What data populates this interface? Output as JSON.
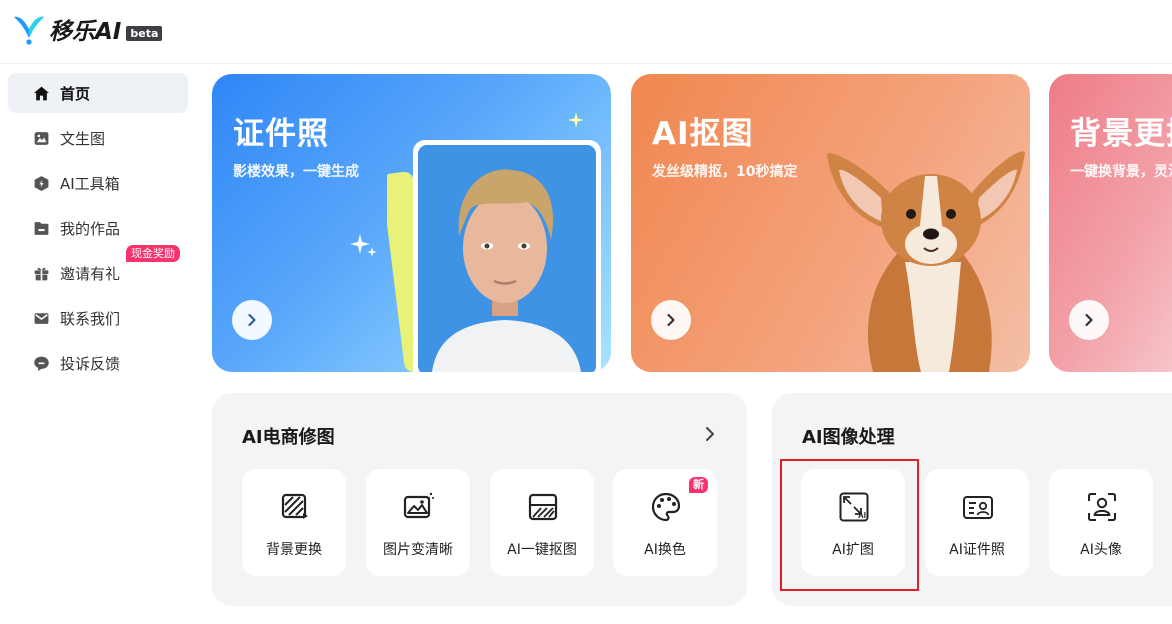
{
  "header": {
    "logo_text": "移乐AI",
    "badge": "beta"
  },
  "sidebar": {
    "items": [
      {
        "label": "首页",
        "icon": "home-icon"
      },
      {
        "label": "文生图",
        "icon": "image-icon"
      },
      {
        "label": "AI工具箱",
        "icon": "toolbox-icon"
      },
      {
        "label": "我的作品",
        "icon": "folder-icon"
      },
      {
        "label": "邀请有礼",
        "icon": "gift-icon",
        "badge": "现金奖励"
      },
      {
        "label": "联系我们",
        "icon": "mail-icon"
      },
      {
        "label": "投诉反馈",
        "icon": "chat-icon"
      }
    ]
  },
  "banners": [
    {
      "title": "证件照",
      "subtitle": "影楼效果，一键生成"
    },
    {
      "title": "AI抠图",
      "subtitle": "发丝级精抠，10秒搞定"
    },
    {
      "title": "背景更换",
      "subtitle": "一键换背景，灵活"
    }
  ],
  "panels": [
    {
      "title": "AI电商修图",
      "tiles": [
        {
          "label": "背景更换",
          "icon": "background-replace-icon"
        },
        {
          "label": "图片变清晰",
          "icon": "image-enhance-icon"
        },
        {
          "label": "AI一键抠图",
          "icon": "cutout-icon"
        },
        {
          "label": "AI换色",
          "icon": "palette-icon",
          "badge": "新"
        }
      ]
    },
    {
      "title": "AI图像处理",
      "tiles": [
        {
          "label": "AI扩图",
          "icon": "expand-image-icon",
          "icon_text": "AI"
        },
        {
          "label": "AI证件照",
          "icon": "id-card-icon"
        },
        {
          "label": "AI头像",
          "icon": "avatar-scan-icon"
        }
      ]
    }
  ],
  "colors": {
    "accent": "#f5336d",
    "highlight": "#e01e28",
    "logo_blue": "#1f9bff"
  }
}
